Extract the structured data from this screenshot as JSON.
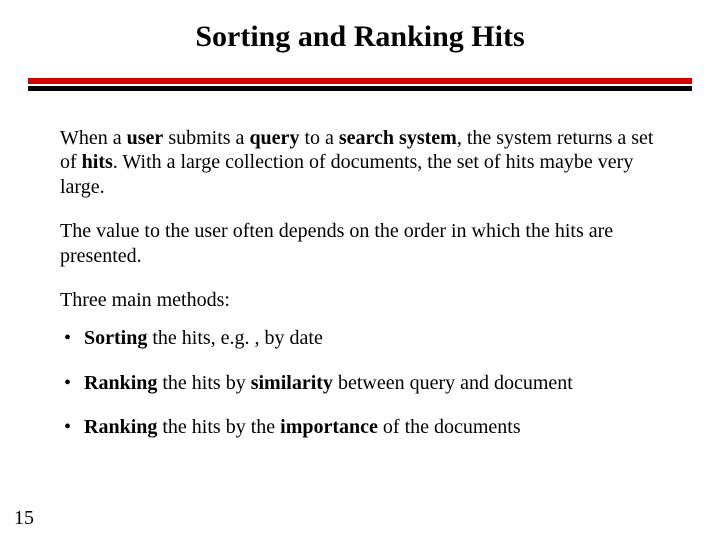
{
  "title": "Sorting and Ranking Hits",
  "para1": {
    "s": [
      {
        "t": "When a "
      },
      {
        "t": "user",
        "b": true
      },
      {
        "t": " submits a "
      },
      {
        "t": "query",
        "b": true
      },
      {
        "t": " to a "
      },
      {
        "t": "search system",
        "b": true
      },
      {
        "t": ", the system returns a set of "
      },
      {
        "t": "hits",
        "b": true
      },
      {
        "t": ".  With a large collection of documents, the set of hits maybe very  large."
      }
    ]
  },
  "para2": "The value to the user often depends on the order in which the hits are presented.",
  "methods_intro": "Three main methods:",
  "bullets": [
    {
      "s": [
        {
          "t": "Sorting",
          "b": true
        },
        {
          "t": " the hits, e.g. , by date"
        }
      ]
    },
    {
      "s": [
        {
          "t": "Ranking",
          "b": true
        },
        {
          "t": " the hits by "
        },
        {
          "t": "similarity",
          "b": true
        },
        {
          "t": " between query and document"
        }
      ]
    },
    {
      "s": [
        {
          "t": "Ranking",
          "b": true
        },
        {
          "t": " the hits by the "
        },
        {
          "t": "importance",
          "b": true
        },
        {
          "t": " of the documents"
        }
      ]
    }
  ],
  "page_number": "15"
}
